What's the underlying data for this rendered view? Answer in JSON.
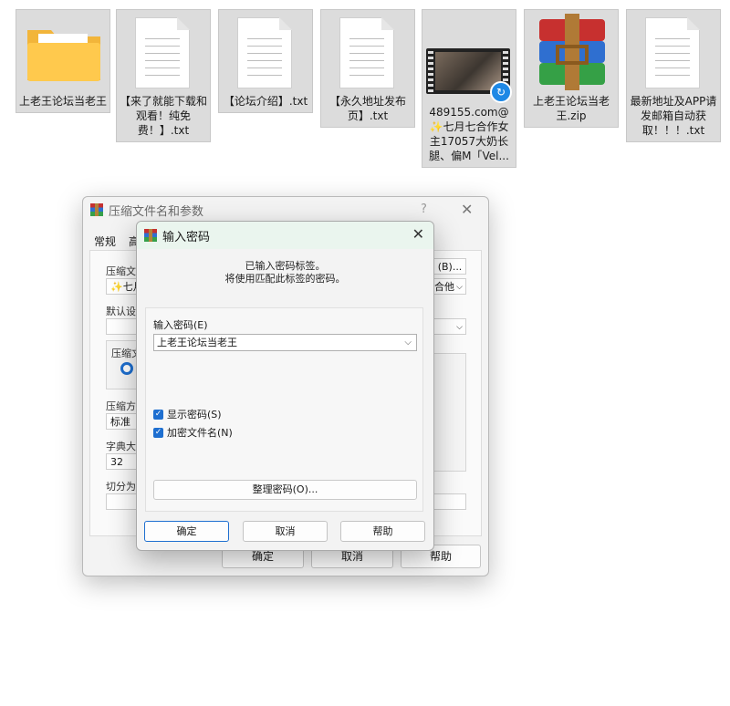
{
  "files": [
    {
      "label": "上老王论坛当老王",
      "icon": "folder-icon"
    },
    {
      "label": "【来了就能下载和观看！纯免费！】.txt",
      "icon": "text-file-icon"
    },
    {
      "label": "【论坛介绍】.txt",
      "icon": "text-file-icon"
    },
    {
      "label": "【永久地址发布页】.txt",
      "icon": "text-file-icon"
    },
    {
      "label": "489155.com@✨七月七合作女主17057大奶长腿、偏M「Vel...",
      "icon": "video-file-icon"
    },
    {
      "label": "上老王论坛当老王.zip",
      "icon": "winrar-archive-icon"
    },
    {
      "label": "最新地址及APP请发邮箱自动获取！！！.txt",
      "icon": "text-file-icon"
    }
  ],
  "archive_dialog": {
    "title": "压缩文件名和参数",
    "help_glyph": "?",
    "close_glyph": "✕",
    "tabs": [
      "常规",
      "高"
    ],
    "archive_name_label": "压缩文件",
    "archive_name_value": "✨七月",
    "browse_label": "(B)...",
    "default_settings_label": "默认设置",
    "dropdown_partial": "合他",
    "compress_format_label": "压缩文",
    "method_label": "压缩方",
    "method_value": "标准",
    "dict_label": "字典大小",
    "dict_value": "32",
    "split_label": "切分为分",
    "ok": "确定",
    "cancel": "取消",
    "help": "帮助"
  },
  "password_dialog": {
    "title": "输入密码",
    "close_glyph": "✕",
    "message_line1": "已输入密码标签。",
    "message_line2": "将使用匹配此标签的密码。",
    "password_label": "输入密码(E)",
    "password_value": "上老王论坛当老王",
    "show_password": "显示密码(S)",
    "encrypt_filenames": "加密文件名(N)",
    "manage_button": "整理密码(O)...",
    "ok": "确定",
    "cancel": "取消",
    "help": "帮助"
  }
}
